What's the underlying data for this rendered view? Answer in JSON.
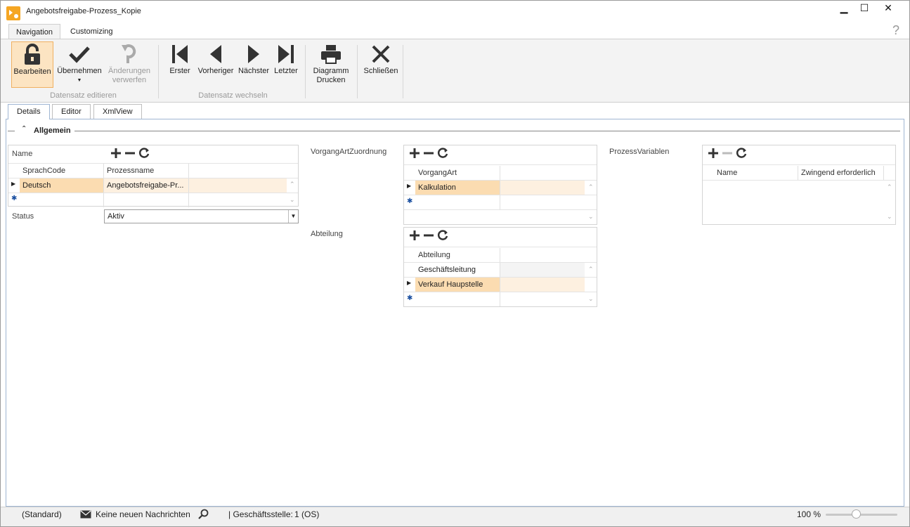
{
  "window": {
    "title": "Angebotsfreigabe-Prozess_Kopie",
    "minimize": "▁",
    "maximize": "☐",
    "close": "✕",
    "help": "?"
  },
  "ribbon": {
    "tabs": [
      {
        "label": "Navigation",
        "active": true
      },
      {
        "label": "Customizing",
        "active": false
      }
    ],
    "buttons": {
      "bearbeiten": "Bearbeiten",
      "uebernehmen": "Übernehmen",
      "aenderungen_1": "Änderungen",
      "aenderungen_2": "verwerfen",
      "erster": "Erster",
      "vorheriger": "Vorheriger",
      "naechster": "Nächster",
      "letzter": "Letzter",
      "diagramm_1": "Diagramm",
      "diagramm_2": "Drucken",
      "schliessen": "Schließen"
    },
    "groups": {
      "edit": "Datensatz editieren",
      "switch": "Datensatz wechseln"
    }
  },
  "page_tabs": [
    {
      "label": "Details",
      "active": true
    },
    {
      "label": "Editor",
      "active": false
    },
    {
      "label": "XmlView",
      "active": false
    }
  ],
  "section": {
    "title": "Allgemein"
  },
  "name_grid": {
    "label": "Name",
    "headers": [
      "SprachCode",
      "Prozessname"
    ],
    "rows": [
      [
        "Deutsch",
        "Angebotsfreigabe-Pr..."
      ]
    ]
  },
  "status": {
    "label": "Status",
    "value": "Aktiv"
  },
  "vorgangart": {
    "label": "VorgangArtZuordnung",
    "header": "VorgangArt",
    "rows": [
      "Kalkulation"
    ]
  },
  "abteilung": {
    "label": "Abteilung",
    "header": "Abteilung",
    "rows": [
      "Geschäftsleitung",
      "Verkauf Haupstelle"
    ]
  },
  "prozessvariablen": {
    "label": "ProzessVariablen",
    "headers": [
      "Name",
      "Zwingend erforderlich"
    ]
  },
  "statusbar": {
    "standard": "(Standard)",
    "messages": "Keine neuen Nachrichten",
    "branch_label": "| Geschäftsstelle:",
    "branch_value": "1 (OS)",
    "zoom": "100 %",
    "zoom_level": 0.42
  },
  "colors": {
    "accent": "#f5a623",
    "selection": "#fbdcb1",
    "tab_border": "#9fb6d3"
  }
}
